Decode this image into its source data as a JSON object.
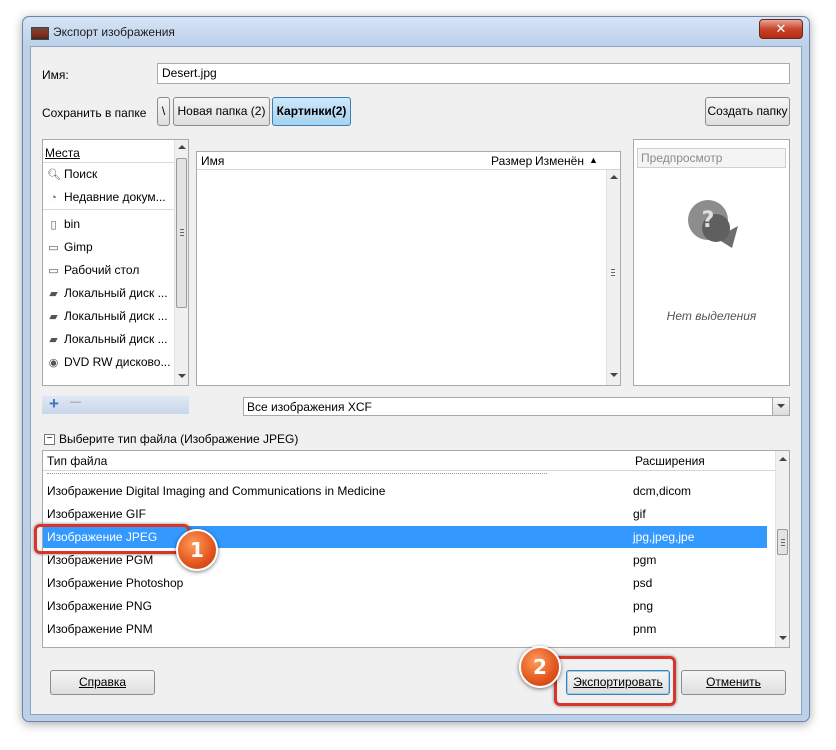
{
  "window": {
    "title": "Экспорт изображения",
    "close_label": "✕"
  },
  "name_row": {
    "label": "Имя:",
    "value": "Desert.jpg"
  },
  "folder_row": {
    "label": "Сохранить в папке",
    "path_buttons": [
      "\\",
      "Новая папка (2)",
      "Картинки(2)"
    ],
    "create_folder": "Создать папку"
  },
  "places": {
    "header": "Места",
    "items": [
      {
        "label": "Поиск",
        "icon": "search-icon"
      },
      {
        "label": "Недавние докум...",
        "icon": "recent-icon"
      },
      {
        "label": "bin",
        "icon": "file-icon"
      },
      {
        "label": "Gimp",
        "icon": "folder-icon"
      },
      {
        "label": "Рабочий стол",
        "icon": "folder-icon"
      },
      {
        "label": "Локальный диск ...",
        "icon": "drive-icon"
      },
      {
        "label": "Локальный диск ...",
        "icon": "drive-icon"
      },
      {
        "label": "Локальный диск ...",
        "icon": "drive-icon"
      },
      {
        "label": "DVD RW дисково...",
        "icon": "dvd-icon"
      }
    ],
    "add_symbol": "+",
    "remove_symbol": "—"
  },
  "files": {
    "col_name": "Имя",
    "col_size": "Размер",
    "col_modified": "Изменён"
  },
  "preview": {
    "label": "Предпросмотр",
    "empty_text": "Нет выделения"
  },
  "filter": {
    "selected": "Все изображения XCF"
  },
  "filetype": {
    "expander_label": "Выберите тип файла (Изображение JPEG)",
    "col_type": "Тип файла",
    "col_ext": "Расширения",
    "rows": [
      {
        "name": "Изображение Digital Imaging and Communications in Medicine",
        "ext": "dcm,dicom"
      },
      {
        "name": "Изображение GIF",
        "ext": "gif"
      },
      {
        "name": "Изображение JPEG",
        "ext": "jpg,jpeg,jpe"
      },
      {
        "name": "Изображение PGM",
        "ext": "pgm"
      },
      {
        "name": "Изображение Photoshop",
        "ext": "psd"
      },
      {
        "name": "Изображение PNG",
        "ext": "png"
      },
      {
        "name": "Изображение PNM",
        "ext": "pnm"
      }
    ],
    "selected_index": 2
  },
  "buttons": {
    "help": "Справка",
    "export": "Экспортировать",
    "cancel": "Отменить"
  },
  "annotations": {
    "badge1": "1",
    "badge2": "2"
  },
  "colors": {
    "selection": "#3399ff",
    "callout": "#d9342b",
    "badge": "#e2541d"
  }
}
